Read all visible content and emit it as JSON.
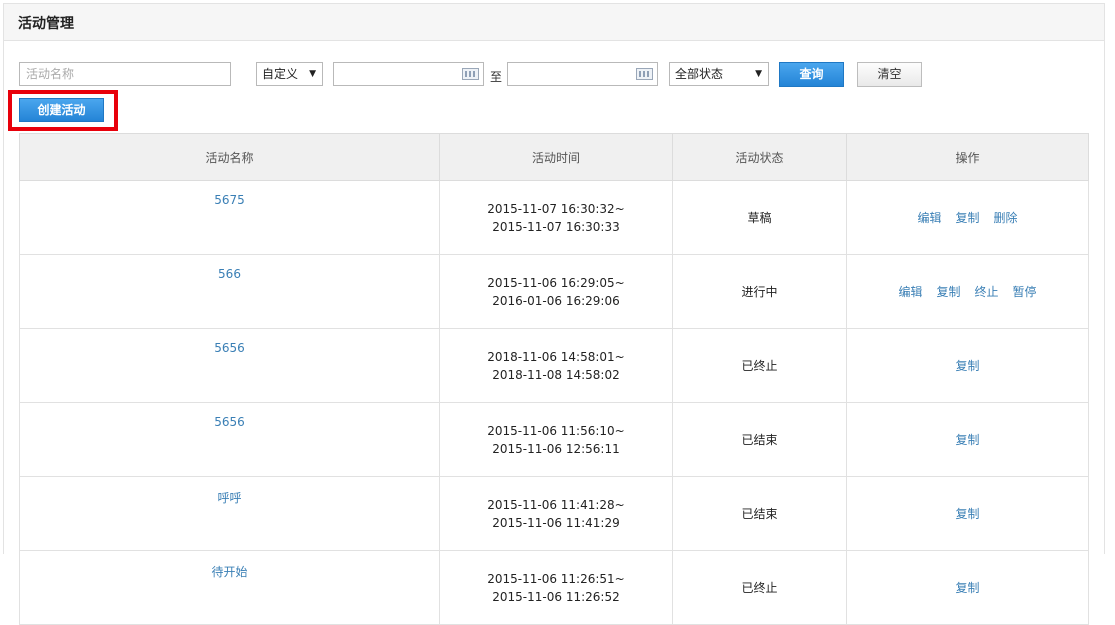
{
  "page": {
    "title": "活动管理"
  },
  "filters": {
    "name_placeholder": "活动名称",
    "date_mode": "自定义",
    "start_date": "",
    "to_label": "至",
    "end_date": "",
    "status": "全部状态",
    "query_label": "查询",
    "clear_label": "清空"
  },
  "create_label": "创建活动",
  "table": {
    "headers": [
      "活动名称",
      "活动时间",
      "活动状态",
      "操作"
    ],
    "rows": [
      {
        "name": "5675",
        "start": "2015-11-07 16:30:32~",
        "end": "2015-11-07 16:30:33",
        "status": "草稿",
        "actions": [
          "编辑",
          "复制",
          "删除"
        ]
      },
      {
        "name": "566",
        "start": "2015-11-06 16:29:05~",
        "end": "2016-01-06 16:29:06",
        "status": "进行中",
        "actions": [
          "编辑",
          "复制",
          "终止",
          "暂停"
        ]
      },
      {
        "name": "5656",
        "start": "2018-11-06 14:58:01~",
        "end": "2018-11-08 14:58:02",
        "status": "已终止",
        "actions": [
          "复制"
        ]
      },
      {
        "name": "5656",
        "start": "2015-11-06 11:56:10~",
        "end": "2015-11-06 12:56:11",
        "status": "已结束",
        "actions": [
          "复制"
        ]
      },
      {
        "name": "呼呼",
        "start": "2015-11-06 11:41:28~",
        "end": "2015-11-06 11:41:29",
        "status": "已结束",
        "actions": [
          "复制"
        ]
      },
      {
        "name": "待开始",
        "start": "2015-11-06 11:26:51~",
        "end": "2015-11-06 11:26:52",
        "status": "已终止",
        "actions": [
          "复制"
        ]
      }
    ]
  }
}
